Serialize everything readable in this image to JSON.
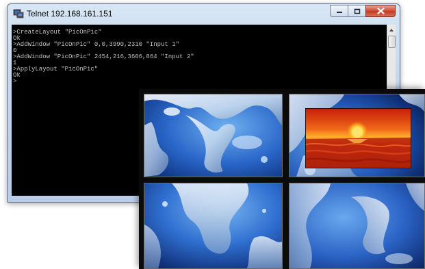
{
  "window": {
    "title": "Telnet 192.168.161.151",
    "icon": "telnet-terminal-icon",
    "buttons": [
      "minimize-icon",
      "maximize-icon",
      "close-icon"
    ]
  },
  "console": {
    "lines": [
      ">CreateLayout \"PicOnPic\"",
      "Ok",
      ">AddWindow \"PicOnPic\" 0,0,3990,2310 \"Input 1\"",
      "0",
      ">AddWindow \"PicOnPic\" 2454,216,3606,864 \"Input 2\"",
      "1",
      ">ApplyLayout \"PicOnPic\"",
      "Ok",
      ">"
    ],
    "colors": {
      "background": "#000000",
      "text": "#c0c0c0"
    }
  },
  "video_wall": {
    "panels": [
      "Input 1 (top-left)",
      "Input 1 (top-right)",
      "Input 1 (bottom-left)",
      "Input 1 (bottom-right)"
    ],
    "pip_content": "sunset-over-sea-image",
    "background_content": "water-splash-image",
    "colors": {
      "bezel": "#0b0b0b",
      "water": "#2f6fd0",
      "sunset": "#e0401a"
    }
  }
}
